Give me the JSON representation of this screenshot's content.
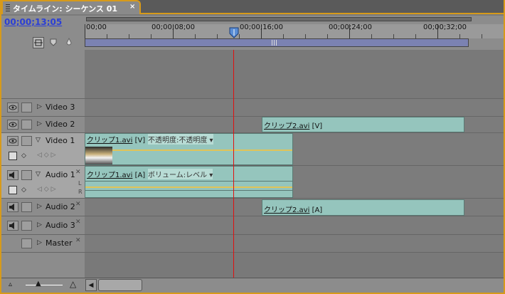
{
  "tab": {
    "title": "タイムライン: シーケンス 01",
    "close": "×"
  },
  "timecode": "00;00;13;05",
  "ruler": {
    "labels": [
      "00;00",
      "00;00;08;00",
      "00;00;16;00",
      "00;00;24;00",
      "00;00;32;00"
    ]
  },
  "playhead_time": "00;00;13;05",
  "tracks": {
    "video3": {
      "name": "Video 3"
    },
    "video2": {
      "name": "Video 2",
      "clip": {
        "name": "クリップ2.avi",
        "tag": "[V]"
      }
    },
    "video1": {
      "name": "Video 1",
      "clip": {
        "name": "クリップ1.avi",
        "tag": "[V]",
        "effect": "不透明度:不透明度 ▾"
      }
    },
    "audio1": {
      "name": "Audio 1",
      "clip": {
        "name": "クリップ1.avi",
        "tag": "[A]",
        "effect": "ボリューム:レベル ▾"
      },
      "ch_left": "L",
      "ch_right": "R"
    },
    "audio2": {
      "name": "Audio 2",
      "clip": {
        "name": "クリップ2.avi",
        "tag": "[A]"
      }
    },
    "audio3": {
      "name": "Audio 3"
    },
    "master": {
      "name": "Master"
    }
  },
  "colors": {
    "accent": "#d79a1a",
    "clip": "#95c5bd",
    "playhead": "#e01010",
    "timecode": "#2b3fd6",
    "workarea": "#7b82b2"
  }
}
